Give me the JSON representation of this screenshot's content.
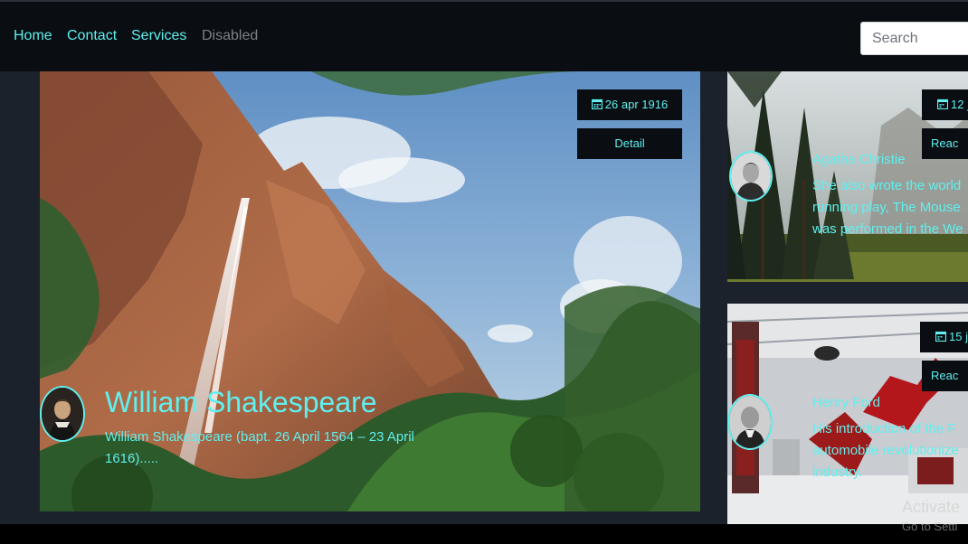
{
  "nav": {
    "links": [
      {
        "label": "Home"
      },
      {
        "label": "Contact"
      },
      {
        "label": "Services"
      },
      {
        "label": "Disabled"
      }
    ],
    "search_placeholder": "Search"
  },
  "featured": {
    "date": "26 apr 1916",
    "button": "Detail",
    "title": "William Shakespeare",
    "excerpt_line1": "William Shakespeare (bapt. 26 April 1564 – 23 April",
    "excerpt_line2": "1616)....."
  },
  "side_cards": [
    {
      "date": "12 j",
      "button": "Reac",
      "name": "Agatha Christie",
      "line1": "She also wrote the world",
      "line2": "running play, The Mouse",
      "line3": "was performed in the We"
    },
    {
      "date": "15 j",
      "button": "Reac",
      "name": "Henry Ford",
      "line1": "His introduction of the F",
      "line2": "automobile revolutionize",
      "line3": "industry."
    }
  ],
  "watermark": {
    "line1": "Activate",
    "line2": "Go to Setti"
  },
  "colors": {
    "accent": "#5ff0ef",
    "navbar": "#0a0d12",
    "page_bg": "#1c222c"
  }
}
